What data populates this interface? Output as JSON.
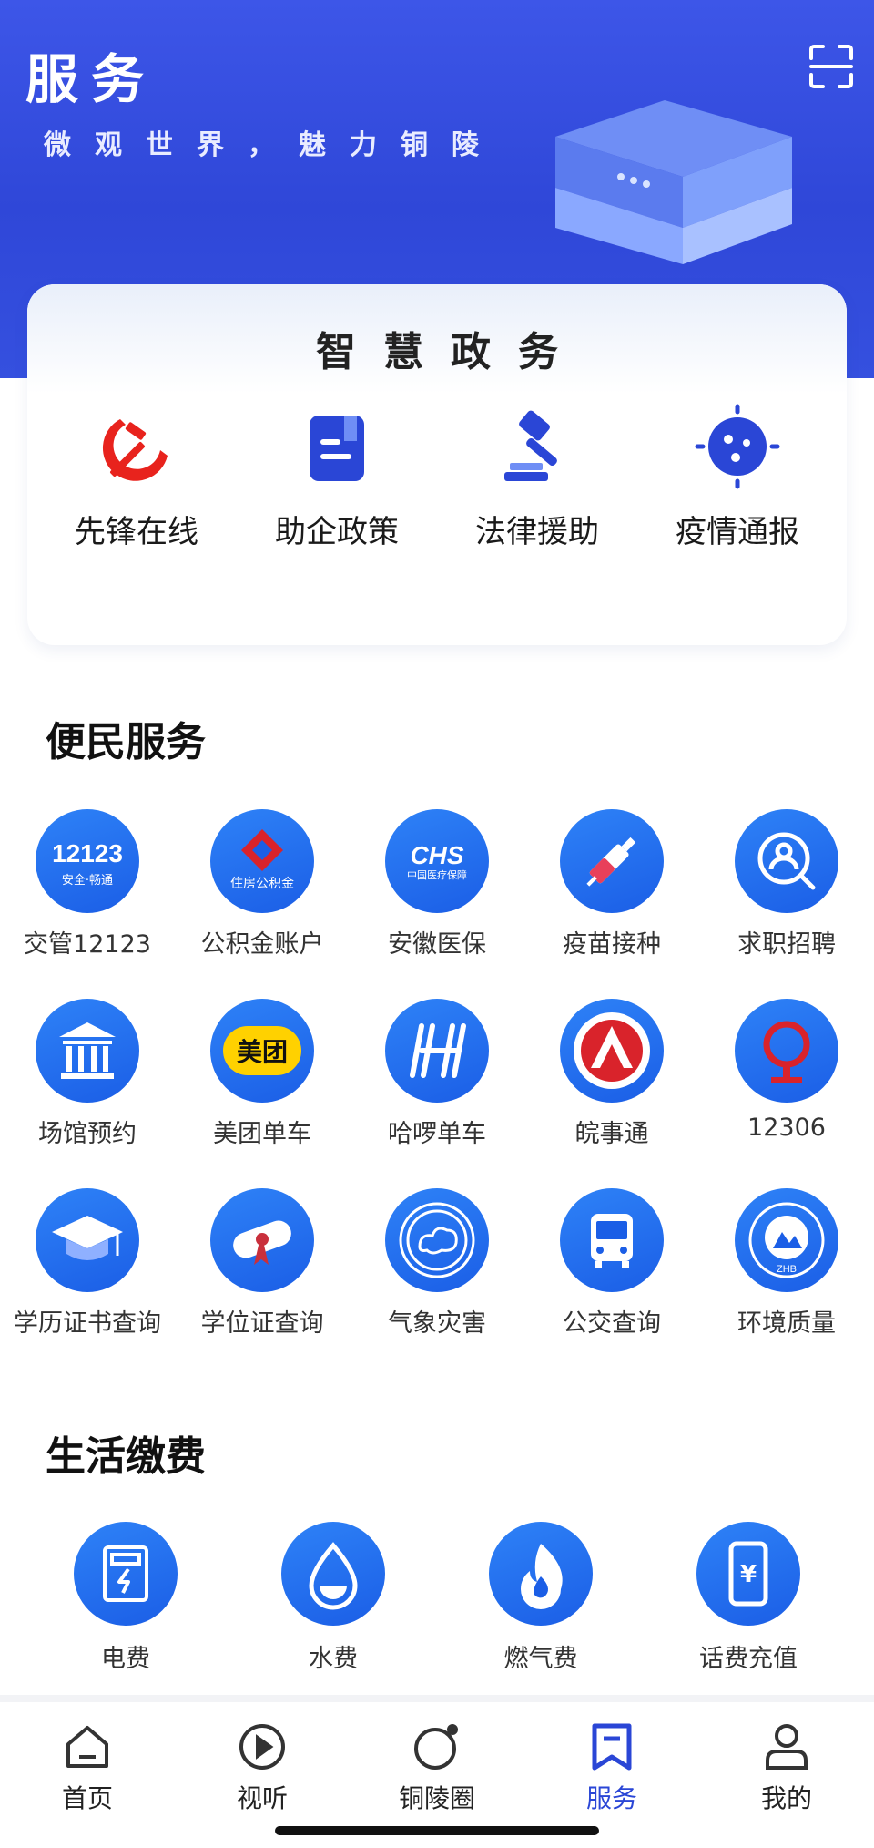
{
  "header": {
    "title": "服务",
    "slogan": "微观世界，魅力铜陵",
    "scan_icon": "scan-icon",
    "background_color": "#3550df"
  },
  "smart_gov": {
    "title": "智慧政务",
    "items": [
      {
        "label": "先锋在线",
        "icon": "party-emblem-icon",
        "color": "#e8231d"
      },
      {
        "label": "助企政策",
        "icon": "document-icon",
        "color": "#2a46d6"
      },
      {
        "label": "法律援助",
        "icon": "gavel-icon",
        "color": "#2a46d6"
      },
      {
        "label": "疫情通报",
        "icon": "virus-icon",
        "color": "#2a46d6"
      }
    ]
  },
  "convenience": {
    "title": "便民服务",
    "items": [
      {
        "label": "交管12123",
        "icon": "traffic-12123-icon",
        "badge_text": "12123",
        "badge_sub": "安全·畅通"
      },
      {
        "label": "公积金账户",
        "icon": "housing-fund-icon",
        "badge_text": "住房公积金"
      },
      {
        "label": "安徽医保",
        "icon": "chs-medical-icon",
        "badge_text": "CHS",
        "badge_sub": "中国医疗保障"
      },
      {
        "label": "疫苗接种",
        "icon": "syringe-icon"
      },
      {
        "label": "求职招聘",
        "icon": "job-search-icon"
      },
      {
        "label": "场馆预约",
        "icon": "venue-icon"
      },
      {
        "label": "美团单车",
        "icon": "meituan-icon",
        "badge_text": "美团"
      },
      {
        "label": "哈啰单车",
        "icon": "hello-bike-icon"
      },
      {
        "label": "皖事通",
        "icon": "wanshitong-icon"
      },
      {
        "label": "12306",
        "icon": "railway-icon"
      },
      {
        "label": "学历证书查询",
        "icon": "graduation-cap-icon"
      },
      {
        "label": "学位证查询",
        "icon": "diploma-icon"
      },
      {
        "label": "气象灾害",
        "icon": "weather-icon"
      },
      {
        "label": "公交查询",
        "icon": "bus-icon"
      },
      {
        "label": "环境质量",
        "icon": "environment-icon",
        "badge_text": "ZHB"
      }
    ]
  },
  "living": {
    "title": "生活缴费",
    "items": [
      {
        "label": "电费",
        "icon": "electricity-meter-icon"
      },
      {
        "label": "水费",
        "icon": "water-drop-icon"
      },
      {
        "label": "燃气费",
        "icon": "flame-icon"
      },
      {
        "label": "话费充值",
        "icon": "phone-recharge-icon",
        "badge_text": "¥"
      }
    ]
  },
  "nav": {
    "items": [
      {
        "label": "首页",
        "icon": "home-icon"
      },
      {
        "label": "视听",
        "icon": "play-icon"
      },
      {
        "label": "铜陵圈",
        "icon": "circle-icon"
      },
      {
        "label": "服务",
        "icon": "bookmark-icon",
        "active": true
      },
      {
        "label": "我的",
        "icon": "profile-icon"
      }
    ],
    "active_color": "#2a46d6"
  }
}
